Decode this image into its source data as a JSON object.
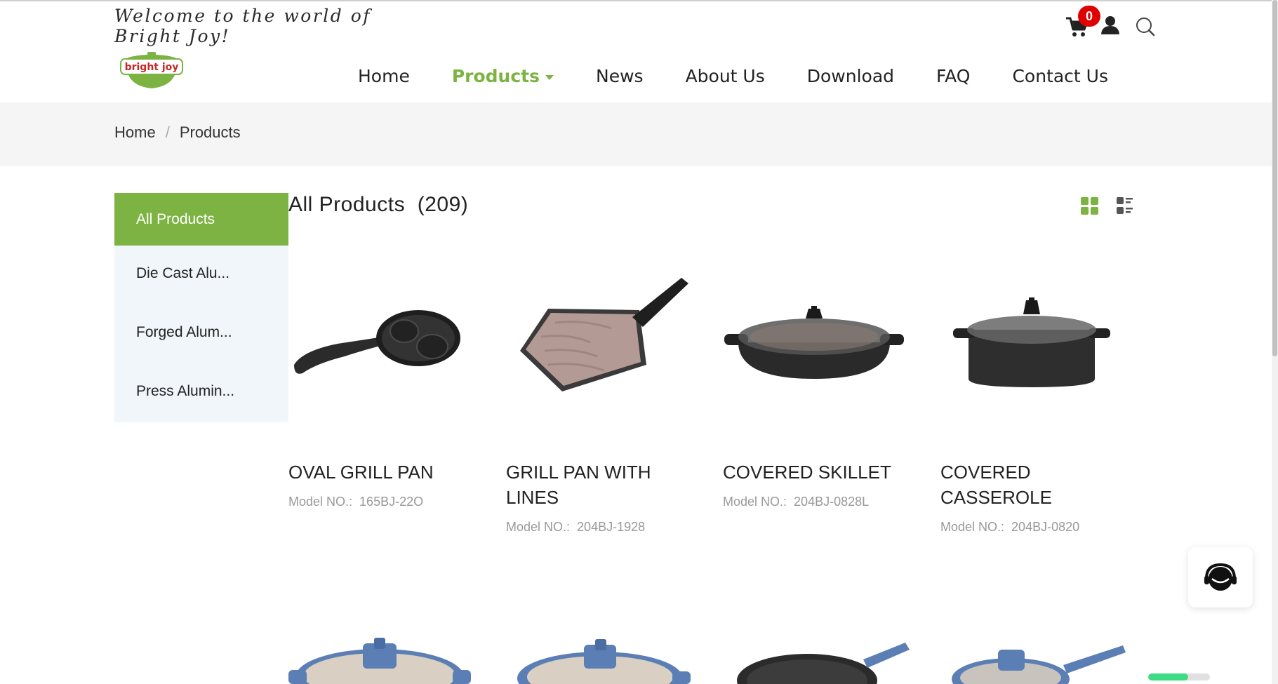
{
  "header": {
    "welcome_text": "Welcome to the world of Bright Joy!",
    "logo_text": "bright joy",
    "cart_count": "0",
    "nav": [
      {
        "label": "Home"
      },
      {
        "label": "Products"
      },
      {
        "label": "News"
      },
      {
        "label": "About Us"
      },
      {
        "label": "Download"
      },
      {
        "label": "FAQ"
      },
      {
        "label": "Contact Us"
      }
    ]
  },
  "breadcrumb": {
    "home": "Home",
    "separator": "/",
    "current": "Products"
  },
  "sidebar": {
    "items": [
      {
        "label": "All Products"
      },
      {
        "label": "Die Cast Alu..."
      },
      {
        "label": "Forged Alum..."
      },
      {
        "label": "Press Alumin..."
      }
    ]
  },
  "main": {
    "title": "All Products",
    "count": "(209)"
  },
  "products": [
    {
      "name": "OVAL GRILL PAN",
      "model_label": "Model NO.:",
      "model": "165BJ-22O"
    },
    {
      "name": "GRILL PAN WITH LINES",
      "model_label": "Model NO.:",
      "model": "204BJ-1928"
    },
    {
      "name": "COVERED SKILLET",
      "model_label": "Model NO.:",
      "model": "204BJ-0828L"
    },
    {
      "name": "COVERED CASSEROLE",
      "model_label": "Model NO.:",
      "model": "204BJ-0820"
    }
  ],
  "colors": {
    "accent_green": "#7cb342",
    "badge_red": "#e00000",
    "sidebar_bg": "#f0f6fa",
    "breadcrumb_bg": "#f5f5f5",
    "cookware_blue": "#5b7fb5"
  },
  "icons": {
    "cart": "cart-icon",
    "user": "user-icon",
    "search": "search-icon",
    "grid_view": "grid-view-icon",
    "list_view": "list-view-icon",
    "chat": "headset-chat-icon"
  },
  "loading_progress": 0.65
}
